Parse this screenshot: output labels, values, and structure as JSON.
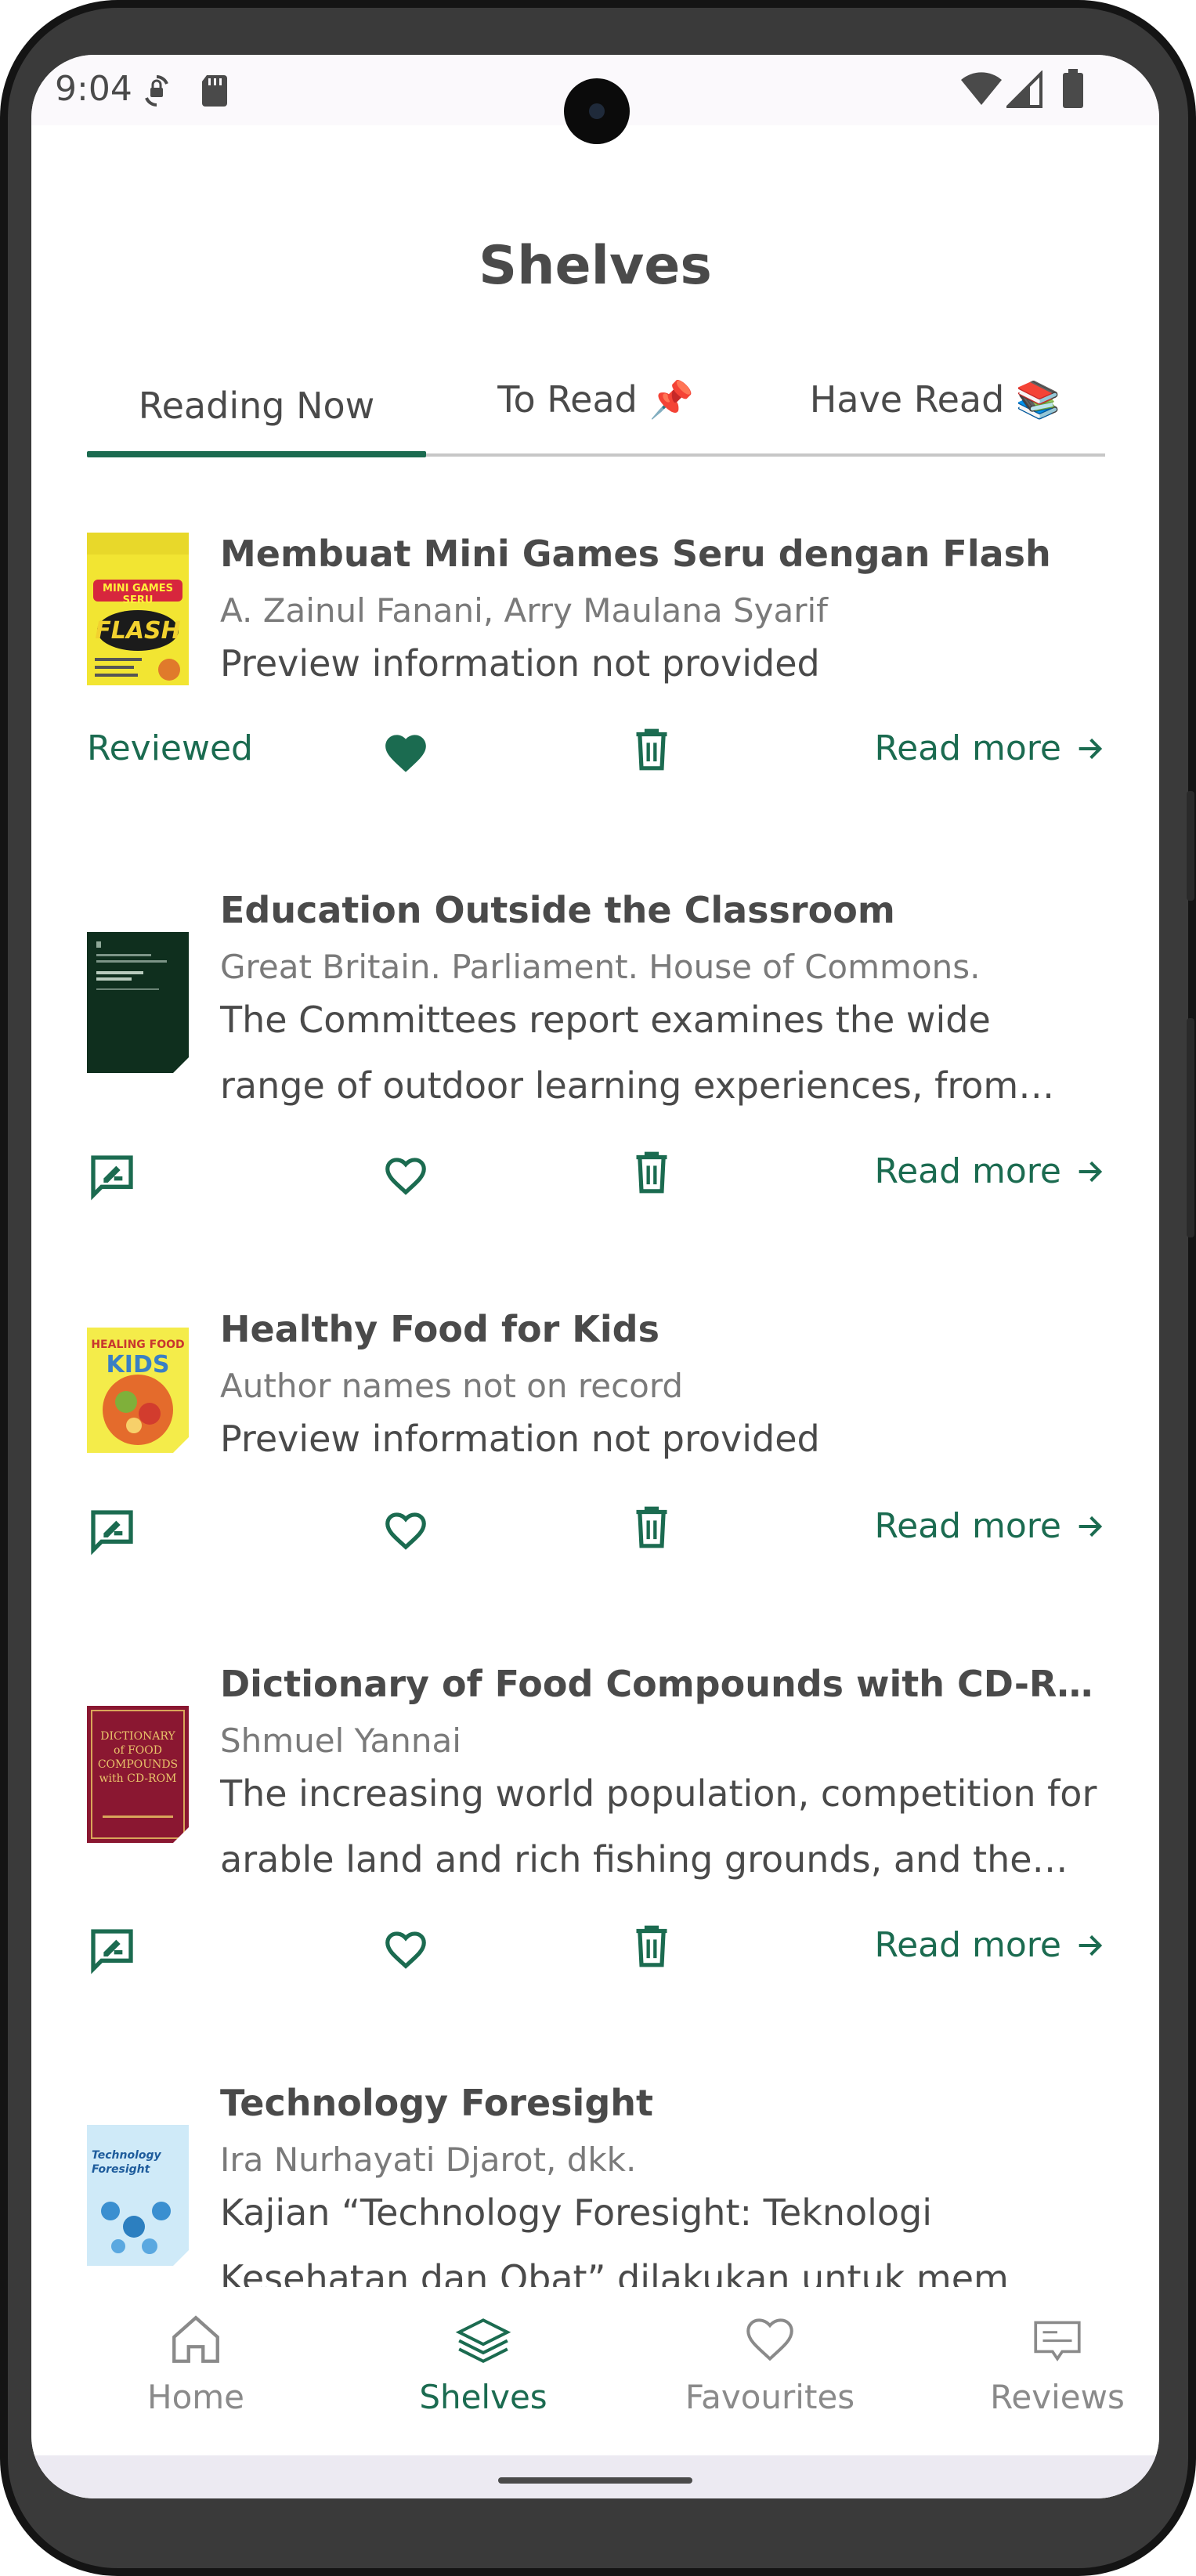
{
  "status_bar": {
    "time": "9:04",
    "icons_left": [
      "sync-lock-icon",
      "sd-card-icon"
    ],
    "icons_right": [
      "wifi-icon",
      "signal-icon",
      "battery-icon"
    ]
  },
  "header": {
    "title": "Shelves"
  },
  "tabs": [
    {
      "label": "Reading Now",
      "active": true
    },
    {
      "label": "To Read 📌",
      "active": false
    },
    {
      "label": "Have Read 📚",
      "active": false
    }
  ],
  "books": [
    {
      "title": "Membuat Mini Games Seru dengan Flash",
      "author": "A. Zainul Fanani, Arry Maulana Syarif",
      "description": "Preview information not provided",
      "review_status": "Reviewed",
      "favourite": true,
      "read_more": "Read more"
    },
    {
      "title": "Education Outside the Classroom",
      "author": "Great Britain. Parliament. House of Commons.",
      "description": "The Committees report examines the wide range of outdoor learning experiences, from school grounds projects to visits abroad",
      "review_status": "",
      "favourite": false,
      "read_more": "Read more"
    },
    {
      "title": "Healthy Food for Kids",
      "author": "Author names not on record",
      "description": "Preview information not provided",
      "review_status": "",
      "favourite": false,
      "read_more": "Read more"
    },
    {
      "title": "Dictionary of Food Compounds with CD-ROM",
      "author": "Shmuel Yannai",
      "description": "The increasing world population, competition for arable land and rich fishing grounds, and the desire for a better quality of life",
      "review_status": "",
      "favourite": false,
      "read_more": "Read more"
    },
    {
      "title": "Technology Foresight",
      "author": "Ira Nurhayati Djarot, dkk.",
      "description": "Kajian “Technology Foresight: Teknologi Kesehatan dan Obat” dilakukan untuk mem",
      "review_status": "",
      "favourite": false,
      "read_more": "Read more"
    }
  ],
  "covers": {
    "flash_text": "FLASH",
    "flash_sub": "MINI GAMES SERU",
    "healthy_text": "HEALING FOOD",
    "healthy_kids": "KIDS",
    "dict_text": "DICTIONARY of FOOD COMPOUNDS with CD-ROM",
    "tech_text": "Technology Foresight"
  },
  "bottom_nav": [
    {
      "label": "Home",
      "icon": "home-icon",
      "active": false
    },
    {
      "label": "Shelves",
      "icon": "shelves-icon",
      "active": true
    },
    {
      "label": "Favourites",
      "icon": "heart-icon",
      "active": false
    },
    {
      "label": "Reviews",
      "icon": "reviews-icon",
      "active": false
    }
  ],
  "colors": {
    "accent": "#1b6b50",
    "text": "#4a4a4a",
    "muted": "#7a7a7a"
  }
}
